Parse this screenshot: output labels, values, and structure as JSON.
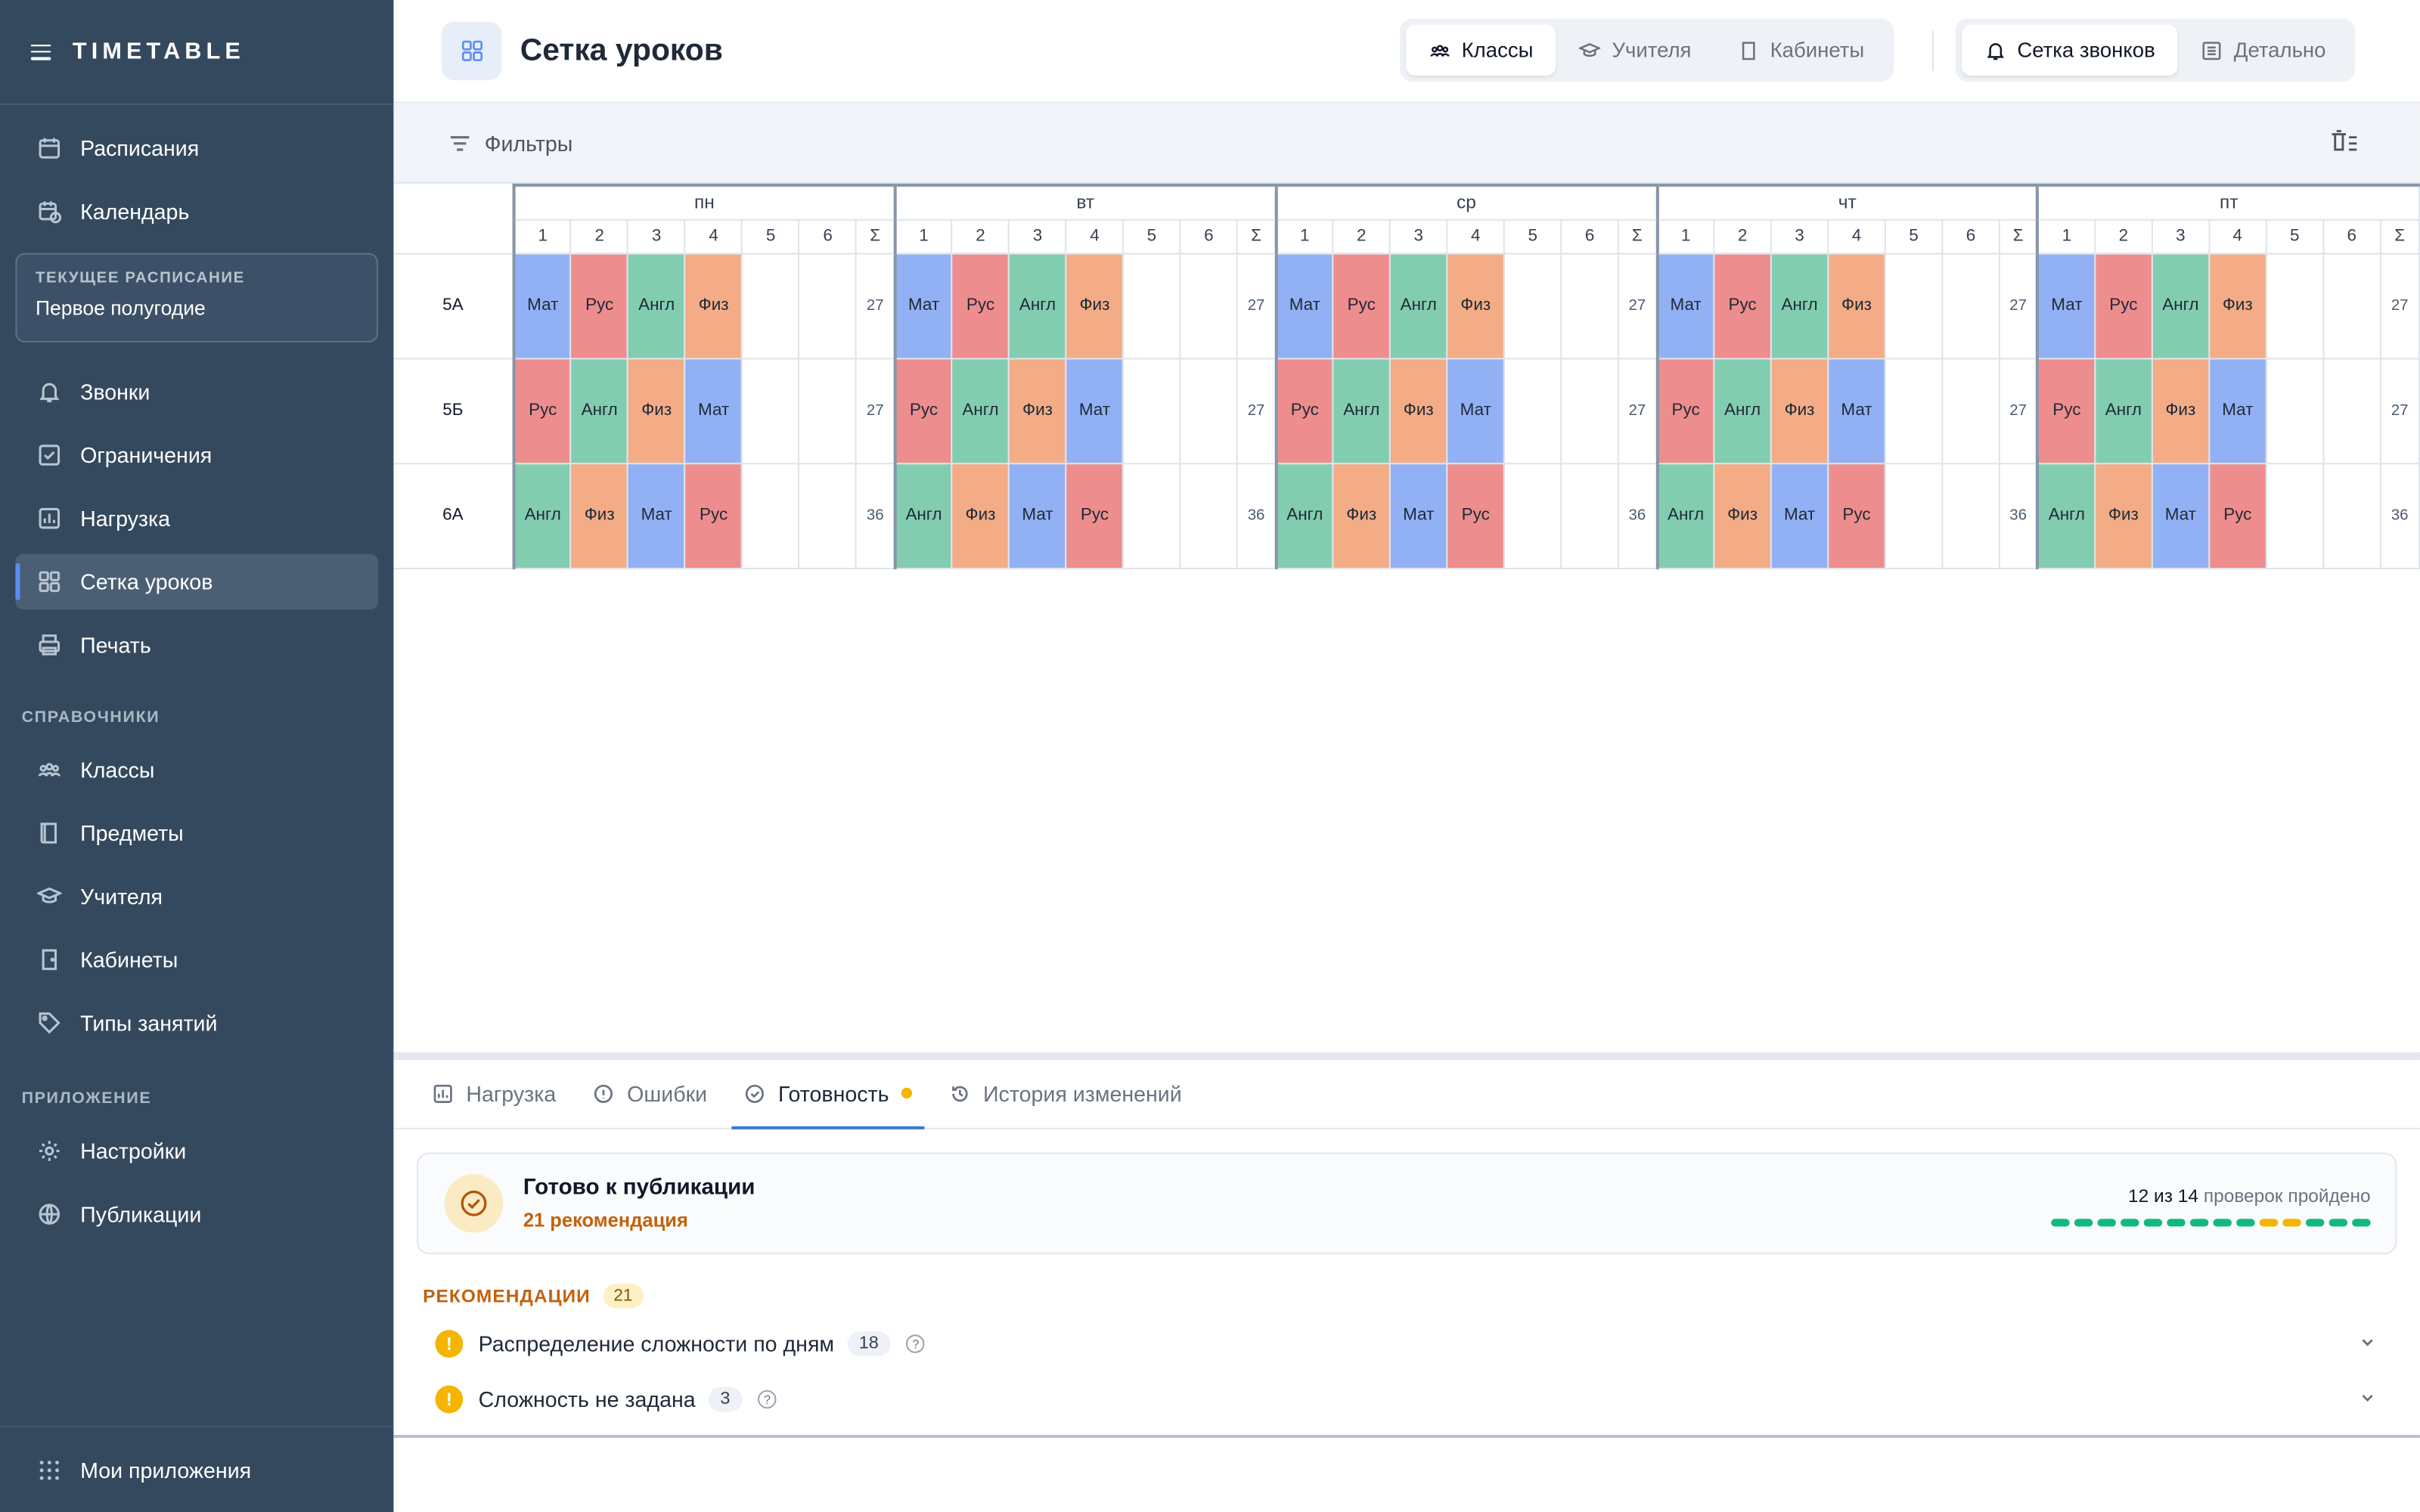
{
  "app": {
    "brand": "TIMETABLE"
  },
  "sidebar": {
    "top_items": [
      {
        "label": "Расписания",
        "icon": "calendar-icon"
      },
      {
        "label": "Календарь",
        "icon": "calendar-clock-icon"
      }
    ],
    "current": {
      "label": "ТЕКУЩЕЕ РАСПИСАНИЕ",
      "value": "Первое полугодие"
    },
    "main_items": [
      {
        "label": "Звонки",
        "icon": "bell-icon"
      },
      {
        "label": "Ограничения",
        "icon": "restriction-icon"
      },
      {
        "label": "Нагрузка",
        "icon": "chart-icon"
      },
      {
        "label": "Сетка уроков",
        "icon": "grid-icon",
        "active": true
      },
      {
        "label": "Печать",
        "icon": "printer-icon"
      }
    ],
    "section_ref": "СПРАВОЧНИКИ",
    "ref_items": [
      {
        "label": "Классы",
        "icon": "classes-icon"
      },
      {
        "label": "Предметы",
        "icon": "book-icon"
      },
      {
        "label": "Учителя",
        "icon": "graduation-cap-icon"
      },
      {
        "label": "Кабинеты",
        "icon": "door-icon"
      },
      {
        "label": "Типы занятий",
        "icon": "tag-icon"
      }
    ],
    "section_app": "ПРИЛОЖЕНИЕ",
    "app_items": [
      {
        "label": "Настройки",
        "icon": "gear-icon"
      },
      {
        "label": "Публикации",
        "icon": "globe-icon"
      }
    ],
    "bottom_label": "Мои приложения"
  },
  "header": {
    "title": "Сетка уроков",
    "view_tabs": [
      {
        "label": "Классы",
        "selected": true
      },
      {
        "label": "Учителя"
      },
      {
        "label": "Кабинеты"
      }
    ],
    "mode_tabs": [
      {
        "label": "Сетка звонков",
        "selected": true
      },
      {
        "label": "Детально"
      }
    ]
  },
  "filters": {
    "label": "Фильтры"
  },
  "grid": {
    "days": [
      "пн",
      "вт",
      "ср",
      "чт",
      "пт"
    ],
    "periods": [
      "1",
      "2",
      "3",
      "4",
      "5",
      "6",
      "Σ"
    ],
    "rows": [
      {
        "class": "5А",
        "lessons": [
          "Мат",
          "Рус",
          "Англ",
          "Физ"
        ],
        "sum": "27"
      },
      {
        "class": "5Б",
        "lessons": [
          "Рус",
          "Англ",
          "Физ",
          "Мат"
        ],
        "sum": "27"
      },
      {
        "class": "6А",
        "lessons": [
          "Англ",
          "Физ",
          "Мат",
          "Рус"
        ],
        "sum": "36"
      }
    ],
    "colors": {
      "Мат": "#92b1f5",
      "Рус": "#ee8d8d",
      "Англ": "#82cdb0",
      "Физ": "#f3ac86"
    }
  },
  "bottom": {
    "tabs": [
      {
        "label": "Нагрузка",
        "icon": "chart-icon"
      },
      {
        "label": "Ошибки",
        "icon": "alert-circle-icon"
      },
      {
        "label": "Готовность",
        "icon": "check-badge-icon",
        "selected": true,
        "dot": true
      },
      {
        "label": "История изменений",
        "icon": "history-icon"
      }
    ],
    "ready": {
      "title": "Готово к публикации",
      "subtitle": "21 рекомендация",
      "checks_done": "12 из 14",
      "checks_suffix": "проверок пройдено",
      "checks": [
        "ok",
        "ok",
        "ok",
        "ok",
        "ok",
        "ok",
        "ok",
        "ok",
        "ok",
        "warn",
        "warn",
        "ok",
        "ok",
        "ok"
      ]
    },
    "rec_title": "РЕКОМЕНДАЦИИ",
    "rec_count": "21",
    "recs": [
      {
        "label": "Распределение сложности по дням",
        "count": "18"
      },
      {
        "label": "Сложность не задана",
        "count": "3"
      }
    ]
  }
}
